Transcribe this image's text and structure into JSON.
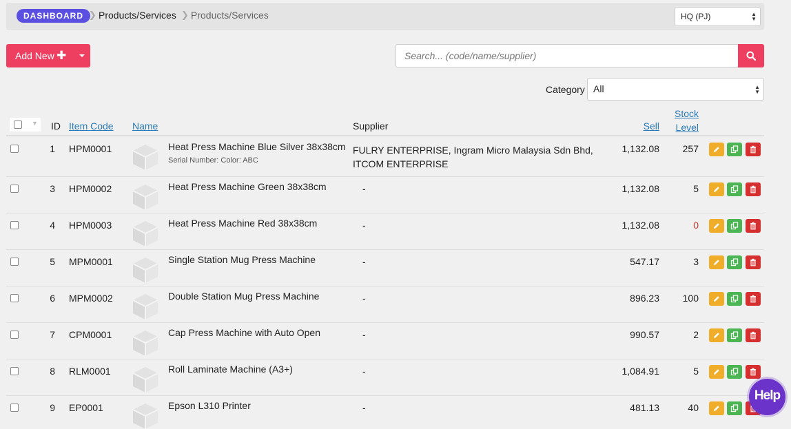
{
  "breadcrumb": {
    "badge": "DASHBOARD",
    "items": [
      "Products/Services",
      "Products/Services"
    ]
  },
  "branch": {
    "selected": "HQ (PJ)"
  },
  "toolbar": {
    "add_new_label": "Add New",
    "add_new_icon": "plus-icon"
  },
  "search": {
    "placeholder": "Search... (code/name/supplier)",
    "value": ""
  },
  "filter": {
    "category_label": "Category",
    "category_selected": "All"
  },
  "table": {
    "headers": {
      "id": "ID",
      "item_code": "Item Code",
      "name": "Name",
      "supplier": "Supplier",
      "sell": "Sell",
      "stock_line1": "Stock",
      "stock_line2": "Level"
    },
    "rows": [
      {
        "id": "1",
        "code": "HPM0001",
        "name": "Heat Press Machine Blue Silver 38x38cm",
        "serial": "Serial Number: Color: ABC",
        "supplier": "FULRY ENTERPRISE, Ingram Micro Malaysia Sdn Bhd, ITCOM ENTERPRISE",
        "sell": "1,132.08",
        "stock": "257"
      },
      {
        "id": "3",
        "code": "HPM0002",
        "name": "Heat Press Machine Green 38x38cm",
        "serial": "",
        "supplier": "-",
        "sell": "1,132.08",
        "stock": "5"
      },
      {
        "id": "4",
        "code": "HPM0003",
        "name": "Heat Press Machine Red 38x38cm",
        "serial": "",
        "supplier": "-",
        "sell": "1,132.08",
        "stock": "0"
      },
      {
        "id": "5",
        "code": "MPM0001",
        "name": "Single Station Mug Press Machine",
        "serial": "",
        "supplier": "-",
        "sell": "547.17",
        "stock": "3"
      },
      {
        "id": "6",
        "code": "MPM0002",
        "name": "Double Station Mug Press Machine",
        "serial": "",
        "supplier": "-",
        "sell": "896.23",
        "stock": "100"
      },
      {
        "id": "7",
        "code": "CPM0001",
        "name": "Cap Press Machine with Auto Open",
        "serial": "",
        "supplier": "-",
        "sell": "990.57",
        "stock": "2"
      },
      {
        "id": "8",
        "code": "RLM0001",
        "name": "Roll Laminate Machine (A3+)",
        "serial": "",
        "supplier": "-",
        "sell": "1,084.91",
        "stock": "5"
      },
      {
        "id": "9",
        "code": "EP0001",
        "name": "Epson L310 Printer",
        "serial": "",
        "supplier": "-",
        "sell": "481.13",
        "stock": "40"
      }
    ]
  },
  "help": {
    "label": "Help"
  },
  "colors": {
    "accent": "#ee3f61",
    "badge": "#5a4fe0",
    "edit": "#f0ad2a",
    "copy": "#4cb553",
    "delete": "#d62f2f",
    "link": "#2a7ab8"
  }
}
